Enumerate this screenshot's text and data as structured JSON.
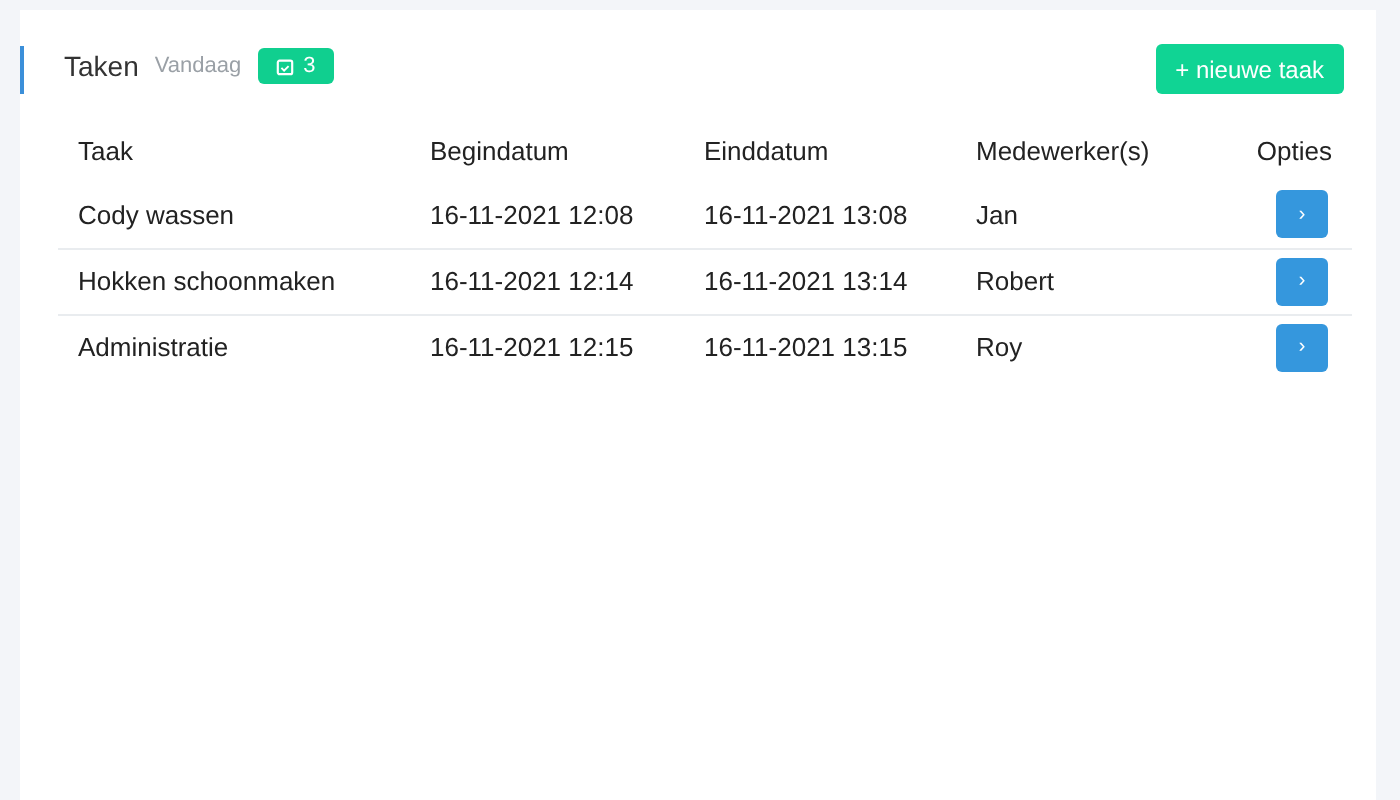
{
  "header": {
    "title": "Taken",
    "subtitle": "Vandaag",
    "count": "3",
    "new_button": "+ nieuwe taak"
  },
  "table": {
    "columns": [
      "Taak",
      "Begindatum",
      "Einddatum",
      "Medewerker(s)",
      "Opties"
    ],
    "rows": [
      {
        "cells": [
          "Cody wassen",
          "16-11-2021 12:08",
          "16-11-2021 13:08",
          "Jan"
        ],
        "action": "›"
      },
      {
        "cells": [
          "Hokken schoonmaken",
          "16-11-2021 12:14",
          "16-11-2021 13:14",
          "Robert"
        ],
        "action": "›"
      },
      {
        "cells": [
          "Administratie",
          "16-11-2021 12:15",
          "16-11-2021 13:15",
          "Roy"
        ],
        "action": "›"
      }
    ]
  }
}
